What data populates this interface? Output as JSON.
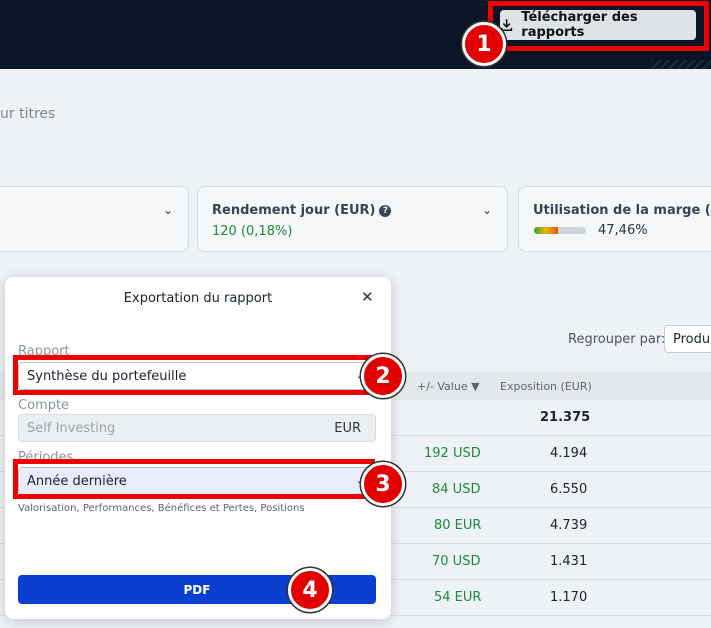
{
  "header": {
    "download_label": "Télécharger des rapports"
  },
  "page": {
    "titles_link": "ur titres"
  },
  "cards": [
    {
      "title": "Rendement jour (EUR)",
      "value": "120 (0,18%)"
    },
    {
      "title": "Utilisation de la marge (EUR)",
      "value": "47,46%",
      "level": 0.47
    }
  ],
  "toolbar": {
    "group_label": "Regrouper par:",
    "group_value": "Produit"
  },
  "table": {
    "headers": [
      "+/- Value",
      "Exposition (EUR)"
    ],
    "total": "21.375",
    "rows": [
      {
        "value": "192 USD",
        "exposure": "4.194"
      },
      {
        "value": "84 USD",
        "exposure": "6.550"
      },
      {
        "value": "80 EUR",
        "exposure": "4.739"
      },
      {
        "value": "70 USD",
        "exposure": "1.431"
      },
      {
        "value": "54 EUR",
        "exposure": "1.170"
      }
    ]
  },
  "modal": {
    "title": "Exportation du rapport",
    "report_label": "Rapport",
    "report_value": "Synthèse du portefeuille",
    "account_label": "Compte",
    "account_value": "Self Investing",
    "account_currency": "EUR",
    "periods_label": "Périodes",
    "periods_value": "Année dernière",
    "hint": "Valorisation, Performances, Bénéfices et Pertes, Positions",
    "pdf_label": "PDF"
  },
  "annotations": [
    "1",
    "2",
    "3",
    "4"
  ],
  "colors": {
    "accent": "#0a3fcf",
    "highlight": "#ee0000",
    "positive": "#1f8a3b",
    "topbar": "#0c1526"
  }
}
